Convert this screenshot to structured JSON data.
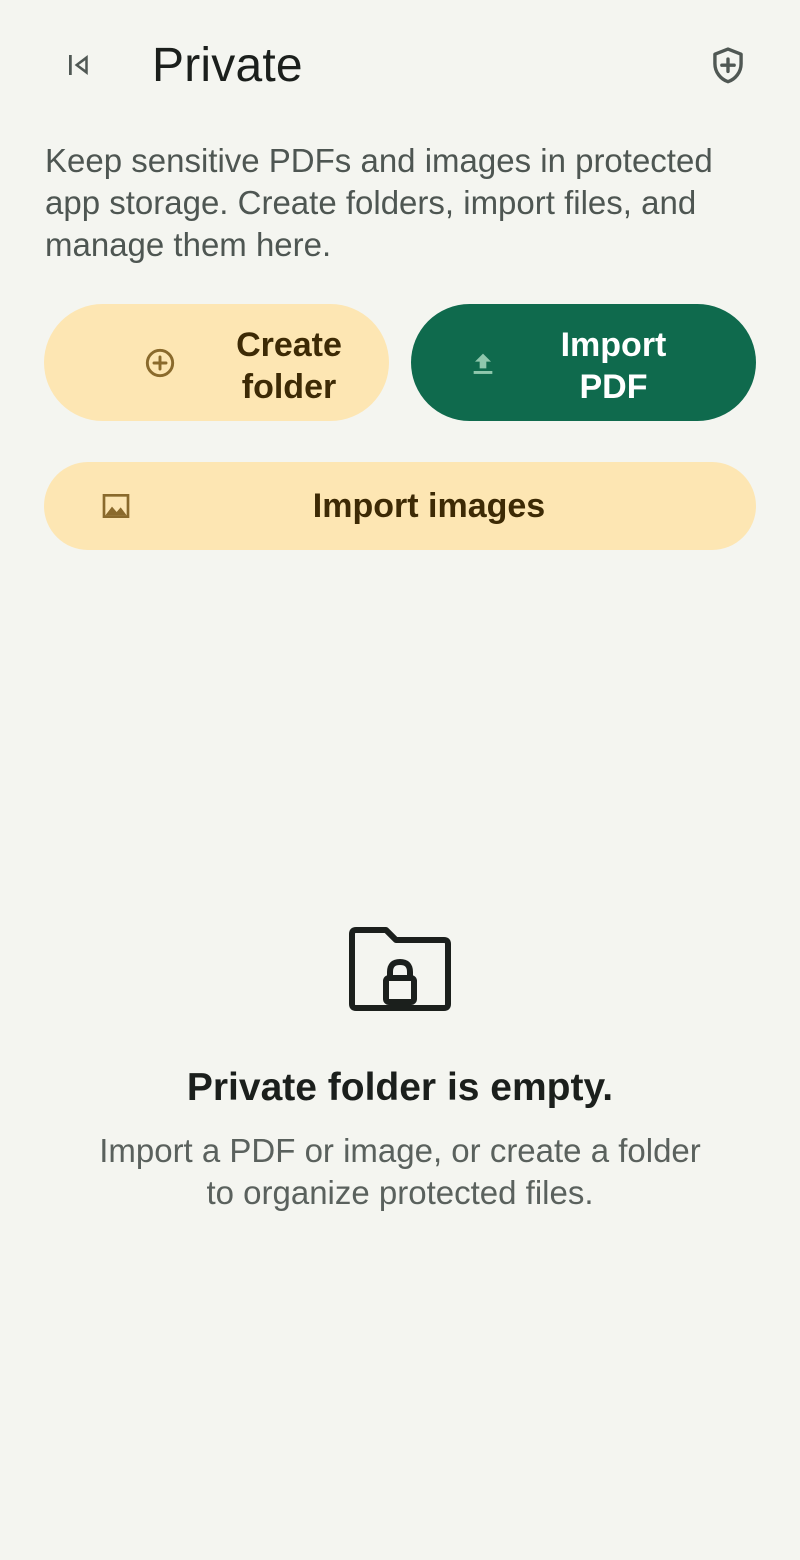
{
  "header": {
    "title": "Private",
    "back_icon": "skip-previous-icon",
    "action_icon": "shield-add-icon"
  },
  "description": "Keep sensitive PDFs and images in protected app storage. Create folders, import files, and manage them here.",
  "actions": {
    "create_folder": {
      "label": "Create folder",
      "icon": "add-circle-icon"
    },
    "import_pdf": {
      "label": "Import PDF",
      "icon": "upload-icon"
    },
    "import_images": {
      "label": "Import images",
      "icon": "image-icon"
    }
  },
  "empty_state": {
    "icon": "locked-folder-icon",
    "title": "Private folder is empty.",
    "subtitle": "Import a PDF or image, or create a folder to organize protected files."
  },
  "colors": {
    "background": "#f4f5f0",
    "tonal_button": "#fde6b3",
    "tonal_text": "#3d2a05",
    "primary_button": "#0f6a4d",
    "primary_text": "#ffffff"
  }
}
